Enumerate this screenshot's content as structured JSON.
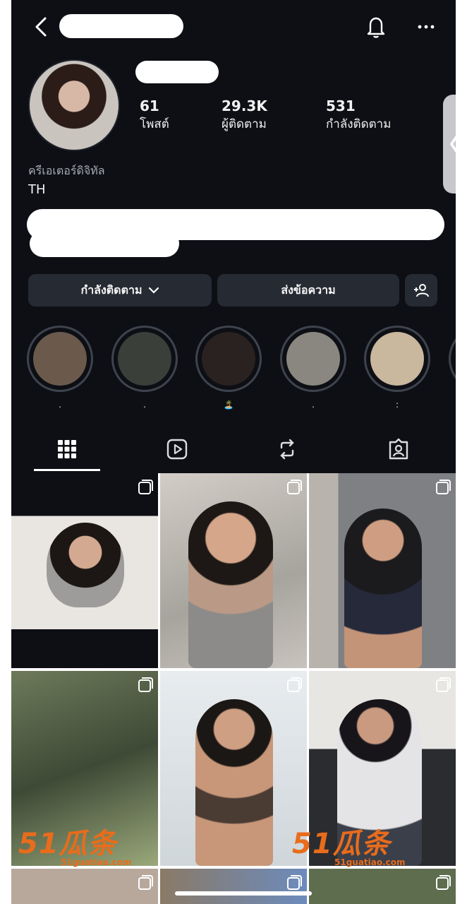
{
  "profile": {
    "stats": [
      {
        "value": "61",
        "label": "โพสต์"
      },
      {
        "value": "29.3K",
        "label": "ผู้ติดตาม"
      },
      {
        "value": "531",
        "label": "กำลังติดตาม"
      }
    ],
    "category": "ครีเอเตอร์ดิจิทัล",
    "location": "TH"
  },
  "actions": {
    "following_label": "กำลังติดตาม",
    "message_label": "ส่งข้อความ"
  },
  "highlights": [
    {
      "label": ".",
      "color": "#6b5a4c"
    },
    {
      "label": ".",
      "color": "#3a3f3a"
    },
    {
      "label": "🏝️",
      "color": "#2a2220"
    },
    {
      "label": ".",
      "color": "#8a8680"
    },
    {
      "label": ":",
      "color": "#c9b79e"
    }
  ],
  "tabs": [
    "grid-icon",
    "reels-icon",
    "reposts-icon",
    "tagged-icon"
  ],
  "watermark": {
    "brand": "51瓜条",
    "site": "51guatiao.com"
  },
  "colors": {
    "background": "#0d0f15",
    "button": "#262a33",
    "watermark": "#e86c1c"
  }
}
